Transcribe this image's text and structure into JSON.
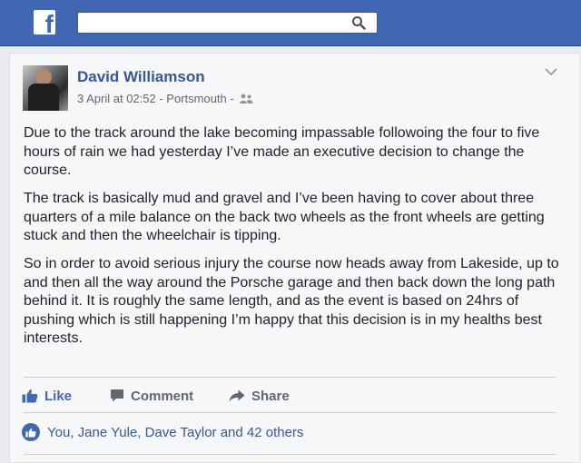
{
  "nav": {
    "logo_letter": "f",
    "search": {
      "value": "",
      "placeholder": ""
    }
  },
  "post": {
    "author": "David Williamson",
    "timestamp": "3 April at 02:52",
    "location": "Portsmouth",
    "separator": " - ",
    "audience_icon": "friends-icon",
    "paragraphs": [
      "Due to the track around the lake becoming impassable followoing the four to five hours of rain we had yesterday I’ve made an executive decision to change the course.",
      "The track is basically mud and gravel and I’ve been having to cover about three quarters of a mile balance on the back two wheels as the front wheels are getting stuck and then the wheelchair is tipping.",
      "So in order to avoid serious injury the course now heads away from Lakeside, up to and then all the way around the Porsche garage and then back down the long path behind it. It is roughly the same length, and as the event is based on 24hrs of pushing which is still happening I’m happy that this decision is in my healths best interests."
    ],
    "actions": {
      "like": "Like",
      "comment": "Comment",
      "share": "Share"
    },
    "reactions_text": "You, Jane Yule, Dave Taylor and 42 others"
  },
  "colors": {
    "brand": "#4267b2",
    "link": "#365899",
    "text": "#1d2129",
    "muted": "#616770"
  }
}
